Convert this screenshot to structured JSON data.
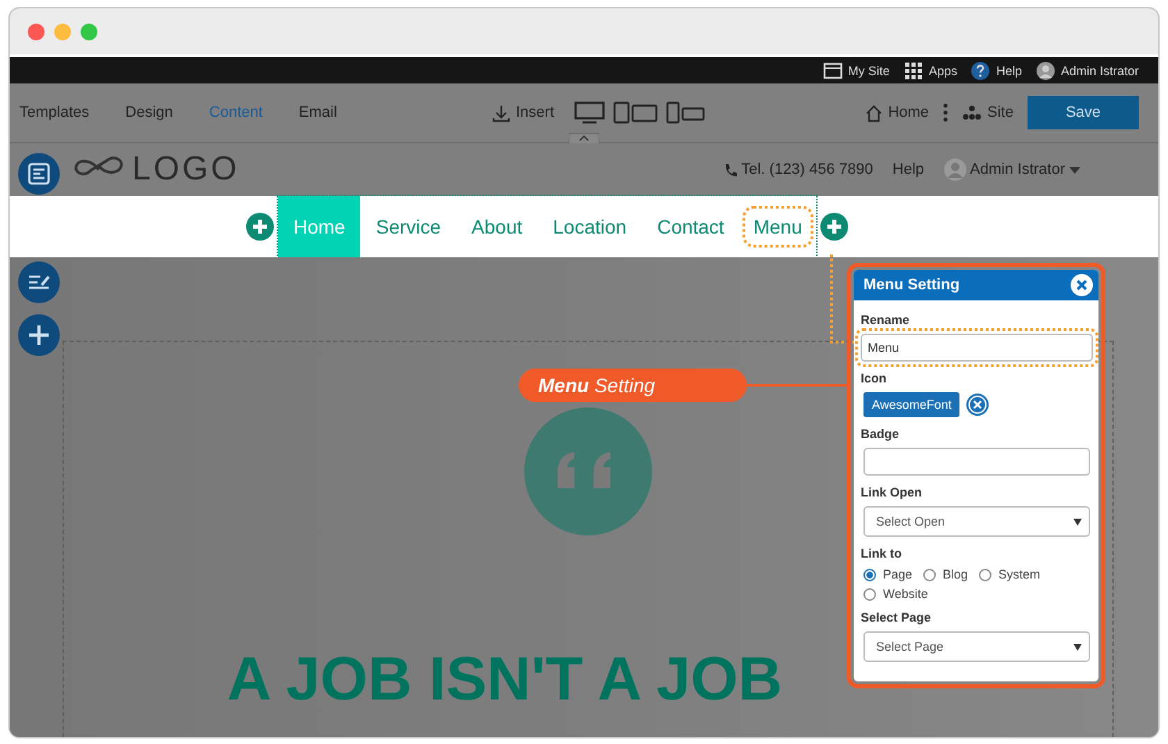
{
  "top_bar": {
    "items": [
      {
        "kind": "site",
        "label": "My Site"
      },
      {
        "kind": "apps",
        "label": "Apps"
      },
      {
        "kind": "help",
        "label": "Help"
      },
      {
        "kind": "user",
        "label": "Admin Istrator"
      }
    ]
  },
  "toolbar": {
    "tabs": [
      {
        "label": "Templates",
        "selected": false
      },
      {
        "label": "Design",
        "selected": false
      },
      {
        "label": "Content",
        "selected": true
      },
      {
        "label": "Email",
        "selected": false
      }
    ],
    "insert": "Insert",
    "home": "Home",
    "site": "Site",
    "save": "Save"
  },
  "site_header": {
    "logo": "LOGO",
    "phone": "Tel. (123) 456 7890",
    "help": "Help",
    "user": "Admin Istrator"
  },
  "nav": {
    "items": [
      {
        "label": "Home",
        "selected": true,
        "editing": false
      },
      {
        "label": "Service",
        "selected": false,
        "editing": false
      },
      {
        "label": "About",
        "selected": false,
        "editing": false
      },
      {
        "label": "Location",
        "selected": false,
        "editing": false
      },
      {
        "label": "Contact",
        "selected": false,
        "editing": false
      },
      {
        "label": "Menu",
        "selected": false,
        "editing": true
      }
    ]
  },
  "hero": {
    "headline": "A JOB ISN'T A JOB"
  },
  "callout": {
    "label": "**Menu** Setting"
  },
  "panel": {
    "title": "Menu Setting",
    "fields": [
      {
        "kind": "text",
        "label": "Rename",
        "value": "Menu",
        "focused": true
      },
      {
        "kind": "tag",
        "label": "Icon",
        "value": "AwesomeFont",
        "focused": false
      },
      {
        "kind": "text",
        "label": "Badge",
        "focused": false
      },
      {
        "kind": "select",
        "label": "Link Open",
        "placeholder": "Select Open",
        "focused": false
      },
      {
        "kind": "radio",
        "label": "Link to",
        "focused": false,
        "options": [
          {
            "label": "Page",
            "selected": true
          },
          {
            "label": "Blog",
            "selected": false
          },
          {
            "label": "System",
            "selected": false
          },
          {
            "label": "Website",
            "selected": false
          }
        ]
      },
      {
        "kind": "select",
        "label": "Select Page",
        "placeholder": "Select Page",
        "focused": false
      }
    ]
  }
}
